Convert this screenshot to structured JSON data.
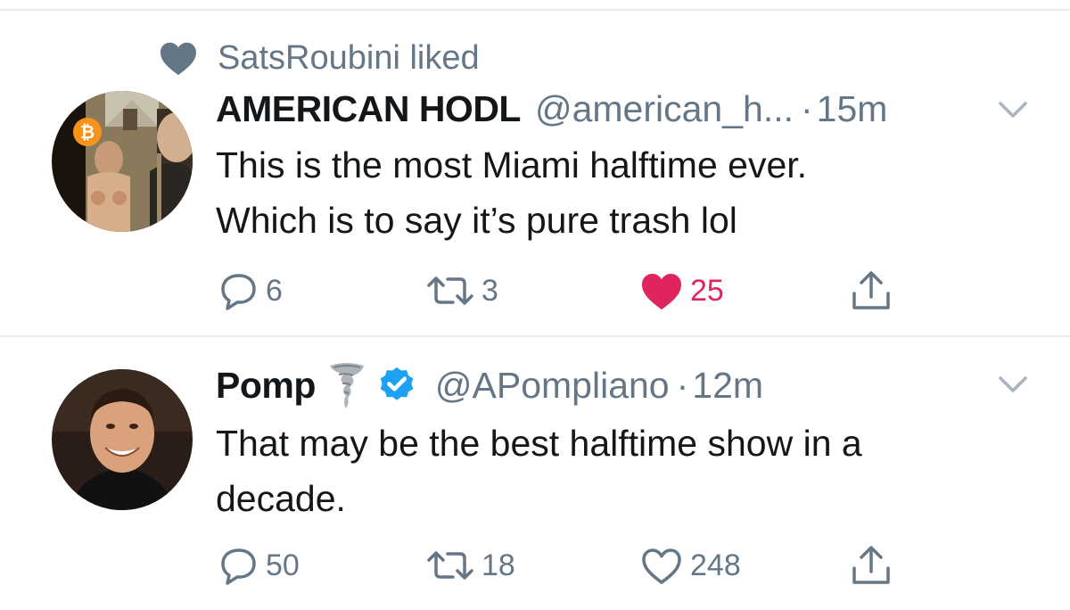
{
  "social_context": {
    "text": "SatsRoubini liked",
    "icon": "heart-icon"
  },
  "tweets": [
    {
      "display_name": "AMERICAN HODL",
      "handle": "@american_h...",
      "separator": "·",
      "time": "15m",
      "text": "This is the most Miami halftime ever.\nWhich is to say it’s pure trash lol",
      "replies": "6",
      "retweets": "3",
      "likes": "25",
      "liked": true
    },
    {
      "display_name": "Pomp",
      "name_emoji": "tornado",
      "verified": true,
      "handle": "@APompliano",
      "separator": "·",
      "time": "12m",
      "text": "That may be the best halftime show in a\ndecade.",
      "replies": "50",
      "retweets": "18",
      "likes": "248",
      "liked": false
    }
  ],
  "colors": {
    "text_primary": "#14171a",
    "text_secondary": "#657786",
    "like_red": "#e0245e",
    "verified_blue": "#1da1f2",
    "divider": "#e6ecf0"
  }
}
